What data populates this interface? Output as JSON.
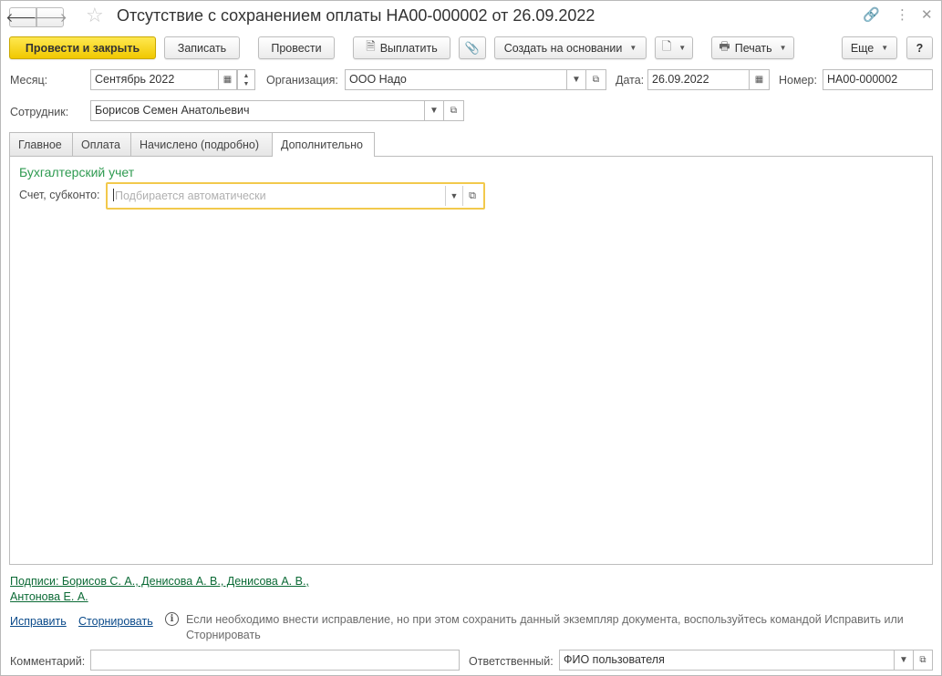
{
  "window": {
    "title": "Отсутствие с сохранением оплаты НА00-000002 от 26.09.2022",
    "icons": [
      "arrow-left-icon",
      "arrow-right-icon",
      "star-icon",
      "link-icon",
      "more-vert-icon",
      "close-icon"
    ]
  },
  "toolbar": {
    "post_and_close": "Провести и закрыть",
    "save": "Записать",
    "post": "Провести",
    "pay": "Выплатить",
    "create_based_on": "Создать на основании",
    "print": "Печать",
    "more": "Еще",
    "help": "?"
  },
  "form": {
    "month_label": "Месяц:",
    "month_value": "Сентябрь 2022",
    "org_label": "Организация:",
    "org_value": "ООО Надо",
    "date_label": "Дата:",
    "date_value": "26.09.2022",
    "number_label": "Номер:",
    "number_value": "НА00-000002",
    "employee_label": "Сотрудник:",
    "employee_value": "Борисов Семен Анатольевич"
  },
  "tabs": [
    {
      "label": "Главное",
      "active": false
    },
    {
      "label": "Оплата",
      "active": false
    },
    {
      "label": "Начислено (подробно)",
      "active": false
    },
    {
      "label": "Дополнительно",
      "active": true
    }
  ],
  "accounting": {
    "section_title": "Бухгалтерский учет",
    "account_label": "Счет, субконто:",
    "account_placeholder": "Подбирается автоматически"
  },
  "footer": {
    "signatures_line1": "Подписи: Борисов С. А., Денисова А. В., Денисова А. В.,",
    "signatures_line2": "Антонова Е. А.",
    "fix_link": "Исправить",
    "storno_link": "Сторнировать",
    "info_text": "Если необходимо внести исправление, но при этом сохранить данный экземпляр документа, воспользуйтесь командой Исправить или Сторнировать",
    "comment_label": "Комментарий:",
    "comment_value": "",
    "responsible_label": "Ответственный:",
    "responsible_value": "ФИО пользователя"
  },
  "colors": {
    "primary_button": "#f5d312",
    "section_title": "#2e9a50",
    "focus_border": "#f2c94c",
    "link_green": "#0b6a35",
    "link_blue": "#0a4a8a"
  }
}
